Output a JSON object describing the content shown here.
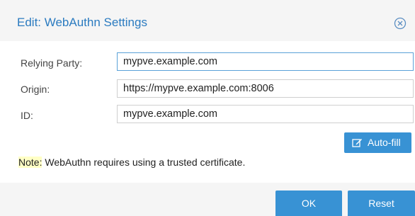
{
  "dialog": {
    "title": "Edit: WebAuthn Settings",
    "close_icon": "close-circle-icon"
  },
  "form": {
    "relying_party": {
      "label": "Relying Party:",
      "value": "mypve.example.com"
    },
    "origin": {
      "label": "Origin:",
      "value": "https://mypve.example.com:8006"
    },
    "id": {
      "label": "ID:",
      "value": "mypve.example.com"
    }
  },
  "autofill": {
    "label": "Auto-fill",
    "icon": "edit-icon"
  },
  "note": {
    "prefix": "Note:",
    "text": " WebAuthn requires using a trusted certificate."
  },
  "footer": {
    "ok_label": "OK",
    "reset_label": "Reset"
  },
  "colors": {
    "accent": "#3892d4",
    "title": "#2b7bc0",
    "note_highlight": "#ffffc5"
  }
}
